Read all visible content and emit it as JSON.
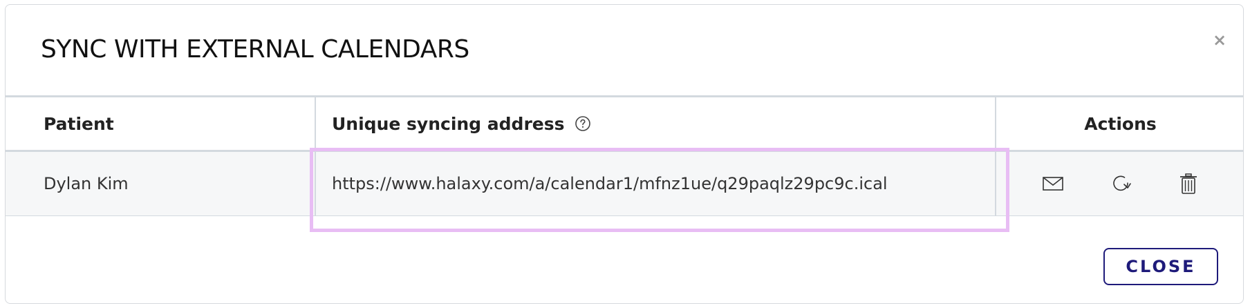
{
  "dialog": {
    "title": "SYNC WITH EXTERNAL CALENDARS",
    "close_icon": "×",
    "close_button_label": "CLOSE"
  },
  "table": {
    "headers": {
      "patient": "Patient",
      "address": "Unique syncing address",
      "actions": "Actions"
    },
    "rows": [
      {
        "patient": "Dylan Kim",
        "address": "https://www.halaxy.com/a/calendar1/mfnz1ue/q29paqlz29pc9c.ical",
        "actions": [
          "mail-icon",
          "refresh-icon",
          "trash-icon"
        ]
      }
    ]
  },
  "colors": {
    "accent": "#1e1a7a",
    "highlight": "#e8bdf4",
    "row_background": "#f6f7f8",
    "border": "#d3d9df"
  }
}
